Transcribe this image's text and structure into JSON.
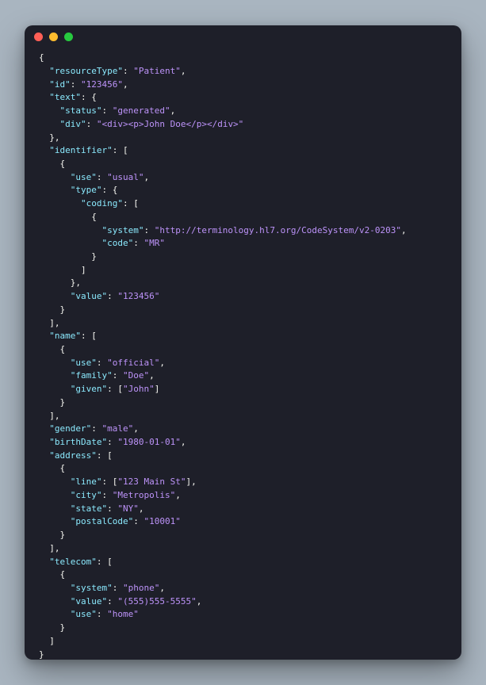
{
  "window": {
    "traffic_lights": [
      "close",
      "minimize",
      "zoom"
    ]
  },
  "code": {
    "lines": [
      [
        [
          "p",
          "{"
        ]
      ],
      [
        [
          "p",
          "  "
        ],
        [
          "k",
          "\"resourceType\""
        ],
        [
          "p",
          ": "
        ],
        [
          "v",
          "\"Patient\""
        ],
        [
          "p",
          ","
        ]
      ],
      [
        [
          "p",
          "  "
        ],
        [
          "k",
          "\"id\""
        ],
        [
          "p",
          ": "
        ],
        [
          "v",
          "\"123456\""
        ],
        [
          "p",
          ","
        ]
      ],
      [
        [
          "p",
          "  "
        ],
        [
          "k",
          "\"text\""
        ],
        [
          "p",
          ": {"
        ]
      ],
      [
        [
          "p",
          "    "
        ],
        [
          "k",
          "\"status\""
        ],
        [
          "p",
          ": "
        ],
        [
          "v",
          "\"generated\""
        ],
        [
          "p",
          ","
        ]
      ],
      [
        [
          "p",
          "    "
        ],
        [
          "k",
          "\"div\""
        ],
        [
          "p",
          ": "
        ],
        [
          "v",
          "\"<div><p>John Doe</p></div>\""
        ]
      ],
      [
        [
          "p",
          "  },"
        ]
      ],
      [
        [
          "p",
          "  "
        ],
        [
          "k",
          "\"identifier\""
        ],
        [
          "p",
          ": ["
        ]
      ],
      [
        [
          "p",
          "    {"
        ]
      ],
      [
        [
          "p",
          "      "
        ],
        [
          "k",
          "\"use\""
        ],
        [
          "p",
          ": "
        ],
        [
          "v",
          "\"usual\""
        ],
        [
          "p",
          ","
        ]
      ],
      [
        [
          "p",
          "      "
        ],
        [
          "k",
          "\"type\""
        ],
        [
          "p",
          ": {"
        ]
      ],
      [
        [
          "p",
          "        "
        ],
        [
          "k",
          "\"coding\""
        ],
        [
          "p",
          ": ["
        ]
      ],
      [
        [
          "p",
          "          {"
        ]
      ],
      [
        [
          "p",
          "            "
        ],
        [
          "k",
          "\"system\""
        ],
        [
          "p",
          ": "
        ],
        [
          "v",
          "\"http://terminology.hl7.org/CodeSystem/v2-0203\""
        ],
        [
          "p",
          ","
        ]
      ],
      [
        [
          "p",
          "            "
        ],
        [
          "k",
          "\"code\""
        ],
        [
          "p",
          ": "
        ],
        [
          "v",
          "\"MR\""
        ]
      ],
      [
        [
          "p",
          "          }"
        ]
      ],
      [
        [
          "p",
          "        ]"
        ]
      ],
      [
        [
          "p",
          "      },"
        ]
      ],
      [
        [
          "p",
          "      "
        ],
        [
          "k",
          "\"value\""
        ],
        [
          "p",
          ": "
        ],
        [
          "v",
          "\"123456\""
        ]
      ],
      [
        [
          "p",
          "    }"
        ]
      ],
      [
        [
          "p",
          "  ],"
        ]
      ],
      [
        [
          "p",
          "  "
        ],
        [
          "k",
          "\"name\""
        ],
        [
          "p",
          ": ["
        ]
      ],
      [
        [
          "p",
          "    {"
        ]
      ],
      [
        [
          "p",
          "      "
        ],
        [
          "k",
          "\"use\""
        ],
        [
          "p",
          ": "
        ],
        [
          "v",
          "\"official\""
        ],
        [
          "p",
          ","
        ]
      ],
      [
        [
          "p",
          "      "
        ],
        [
          "k",
          "\"family\""
        ],
        [
          "p",
          ": "
        ],
        [
          "v",
          "\"Doe\""
        ],
        [
          "p",
          ","
        ]
      ],
      [
        [
          "p",
          "      "
        ],
        [
          "k",
          "\"given\""
        ],
        [
          "p",
          ": ["
        ],
        [
          "v",
          "\"John\""
        ],
        [
          "p",
          "]"
        ]
      ],
      [
        [
          "p",
          "    }"
        ]
      ],
      [
        [
          "p",
          "  ],"
        ]
      ],
      [
        [
          "p",
          "  "
        ],
        [
          "k",
          "\"gender\""
        ],
        [
          "p",
          ": "
        ],
        [
          "v",
          "\"male\""
        ],
        [
          "p",
          ","
        ]
      ],
      [
        [
          "p",
          "  "
        ],
        [
          "k",
          "\"birthDate\""
        ],
        [
          "p",
          ": "
        ],
        [
          "v",
          "\"1980-01-01\""
        ],
        [
          "p",
          ","
        ]
      ],
      [
        [
          "p",
          "  "
        ],
        [
          "k",
          "\"address\""
        ],
        [
          "p",
          ": ["
        ]
      ],
      [
        [
          "p",
          "    {"
        ]
      ],
      [
        [
          "p",
          "      "
        ],
        [
          "k",
          "\"line\""
        ],
        [
          "p",
          ": ["
        ],
        [
          "v",
          "\"123 Main St\""
        ],
        [
          "p",
          "],"
        ]
      ],
      [
        [
          "p",
          "      "
        ],
        [
          "k",
          "\"city\""
        ],
        [
          "p",
          ": "
        ],
        [
          "v",
          "\"Metropolis\""
        ],
        [
          "p",
          ","
        ]
      ],
      [
        [
          "p",
          "      "
        ],
        [
          "k",
          "\"state\""
        ],
        [
          "p",
          ": "
        ],
        [
          "v",
          "\"NY\""
        ],
        [
          "p",
          ","
        ]
      ],
      [
        [
          "p",
          "      "
        ],
        [
          "k",
          "\"postalCode\""
        ],
        [
          "p",
          ": "
        ],
        [
          "v",
          "\"10001\""
        ]
      ],
      [
        [
          "p",
          "    }"
        ]
      ],
      [
        [
          "p",
          "  ],"
        ]
      ],
      [
        [
          "p",
          "  "
        ],
        [
          "k",
          "\"telecom\""
        ],
        [
          "p",
          ": ["
        ]
      ],
      [
        [
          "p",
          "    {"
        ]
      ],
      [
        [
          "p",
          "      "
        ],
        [
          "k",
          "\"system\""
        ],
        [
          "p",
          ": "
        ],
        [
          "v",
          "\"phone\""
        ],
        [
          "p",
          ","
        ]
      ],
      [
        [
          "p",
          "      "
        ],
        [
          "k",
          "\"value\""
        ],
        [
          "p",
          ": "
        ],
        [
          "v",
          "\"(555)555-5555\""
        ],
        [
          "p",
          ","
        ]
      ],
      [
        [
          "p",
          "      "
        ],
        [
          "k",
          "\"use\""
        ],
        [
          "p",
          ": "
        ],
        [
          "v",
          "\"home\""
        ]
      ],
      [
        [
          "p",
          "    }"
        ]
      ],
      [
        [
          "p",
          "  ]"
        ]
      ],
      [
        [
          "p",
          "}"
        ]
      ]
    ]
  },
  "colors": {
    "bg": "#1e1f29",
    "key": "#8be9fd",
    "value": "#bd93f9",
    "punct": "#f8f8f2"
  }
}
